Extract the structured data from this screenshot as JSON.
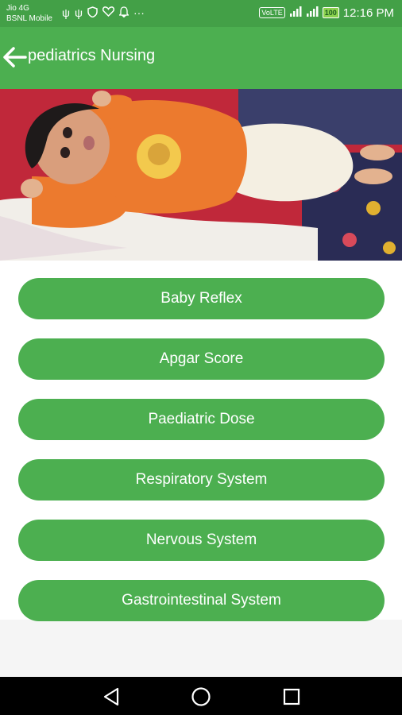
{
  "status_bar": {
    "carrier_line1": "Jio 4G",
    "carrier_line2": "BSNL Mobile",
    "left_icons": [
      "usb-icon",
      "usb-icon",
      "shield-icon",
      "heart-icon",
      "bell-icon",
      "more-dots-icon"
    ],
    "volte_badge": "VoLTE",
    "battery_label": "100",
    "time": "12:16 PM"
  },
  "app_bar": {
    "title": "pediatrics Nursing",
    "back_icon": "arrow-left-icon"
  },
  "hero": {
    "image": "baby-photo"
  },
  "menu": {
    "items": [
      {
        "label": "Baby Reflex"
      },
      {
        "label": "Apgar Score"
      },
      {
        "label": "Paediatric Dose"
      },
      {
        "label": "Respiratory System"
      },
      {
        "label": "Nervous System"
      },
      {
        "label": "Gastrointestinal System"
      }
    ]
  },
  "nav_bar": {
    "buttons": [
      "back-triangle-icon",
      "home-circle-icon",
      "recents-square-icon"
    ]
  },
  "colors": {
    "primary": "#4caf50",
    "status_bar": "#43a047",
    "button_text": "#ffffff"
  }
}
